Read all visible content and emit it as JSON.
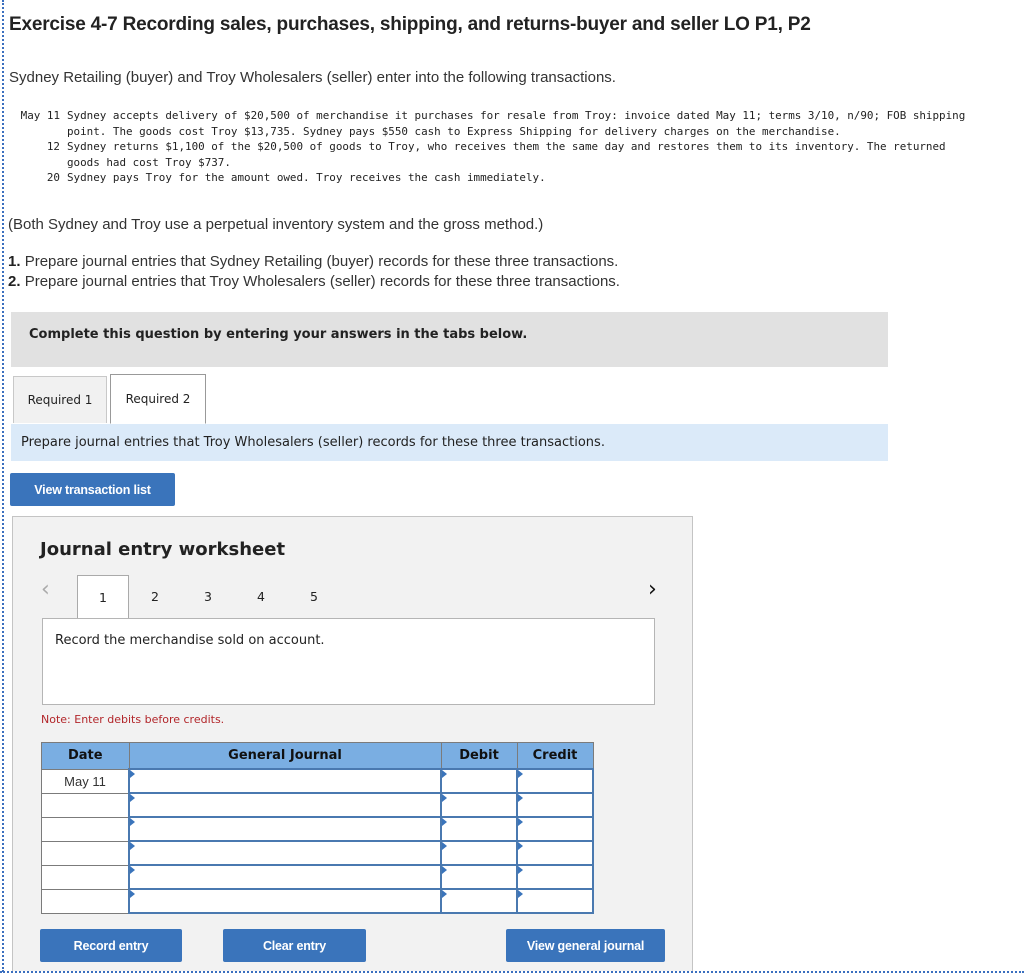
{
  "header": {
    "title": "Exercise 4-7 Recording sales, purchases, shipping, and returns-buyer and seller LO P1, P2",
    "intro": "Sydney Retailing (buyer) and Troy Wholesalers (seller) enter into the following transactions."
  },
  "transactions": [
    {
      "date": "May 11",
      "text": "Sydney accepts delivery of $20,500 of merchandise it purchases for resale from Troy: invoice dated May 11; terms 3/10, n/90; FOB shipping point. The goods cost Troy $13,735. Sydney pays $550 cash to Express Shipping for delivery charges on the merchandise."
    },
    {
      "date": "12",
      "text": "Sydney returns $1,100 of the $20,500 of goods to Troy, who receives them the same day and restores them to its inventory. The returned goods had cost Troy $737."
    },
    {
      "date": "20",
      "text": "Sydney pays Troy for the amount owed. Troy receives the cash immediately."
    }
  ],
  "note": "(Both Sydney and Troy use a perpetual inventory system and the gross method.)",
  "requirements": [
    {
      "num": "1.",
      "text": "Prepare journal entries that Sydney Retailing (buyer) records for these three transactions."
    },
    {
      "num": "2.",
      "text": "Prepare journal entries that Troy Wholesalers (seller) records for these three transactions."
    }
  ],
  "instruction_bar": "Complete this question by entering your answers in the tabs below.",
  "tabs": [
    {
      "label": "Required 1",
      "active": false
    },
    {
      "label": "Required 2",
      "active": true
    }
  ],
  "tab_description": "Prepare journal entries that Troy Wholesalers (seller) records for these three transactions.",
  "buttons": {
    "view_transaction_list": "View transaction list",
    "record_entry": "Record entry",
    "clear_entry": "Clear entry",
    "view_general_journal": "View general journal"
  },
  "worksheet": {
    "title": "Journal entry worksheet",
    "prev_icon": "‹",
    "next_icon": "›",
    "steps": [
      "1",
      "2",
      "3",
      "4",
      "5"
    ],
    "active_step": "1",
    "description": "Record the merchandise sold on account.",
    "note": "Note: Enter debits before credits.",
    "table": {
      "headers": [
        "Date",
        "General Journal",
        "Debit",
        "Credit"
      ],
      "rows": [
        {
          "date": "May 11",
          "account": "",
          "debit": "",
          "credit": ""
        },
        {
          "date": "",
          "account": "",
          "debit": "",
          "credit": ""
        },
        {
          "date": "",
          "account": "",
          "debit": "",
          "credit": ""
        },
        {
          "date": "",
          "account": "",
          "debit": "",
          "credit": ""
        },
        {
          "date": "",
          "account": "",
          "debit": "",
          "credit": ""
        },
        {
          "date": "",
          "account": "",
          "debit": "",
          "credit": ""
        }
      ]
    }
  },
  "colors": {
    "button_blue": "#3a74bb",
    "table_header": "#7aaee2",
    "note_red": "#b2262a",
    "tab_desc_bg": "#dbeaf9"
  }
}
